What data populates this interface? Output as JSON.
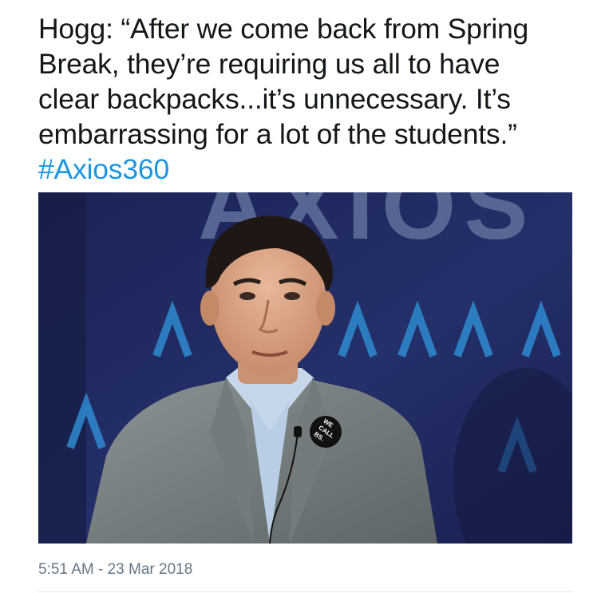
{
  "tweet": {
    "lines": [
      "Hogg: “After we come back from Spring",
      "Break, they’re requiring us all to have",
      "clear backpacks...it’s unnecessary. It’s",
      "embarrassing for a lot of the students.”"
    ],
    "hashtag": "#Axios360",
    "timestamp": "5:51 AM - 23 Mar 2018"
  },
  "photo": {
    "backdrop_text": "AXIOS",
    "pin_lines": [
      "WE",
      "CALL",
      "BS."
    ]
  },
  "colors": {
    "text": "#14171a",
    "hashtag": "#1b95e0",
    "timestamp": "#657786",
    "backdrop": "#21295e"
  }
}
